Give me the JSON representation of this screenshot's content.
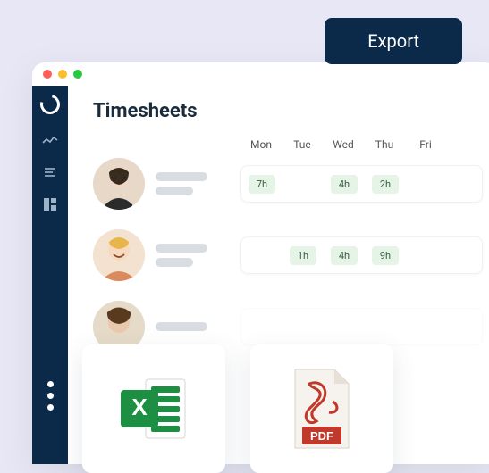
{
  "export_button": "Export",
  "page_title": "Timesheets",
  "days": [
    "Mon",
    "Tue",
    "Wed",
    "Thu",
    "Fri"
  ],
  "rows": [
    {
      "hours": [
        "7h",
        "",
        "4h",
        "2h",
        ""
      ]
    },
    {
      "hours": [
        "",
        "1h",
        "4h",
        "9h",
        ""
      ]
    },
    {
      "hours": [
        "",
        "",
        "",
        "",
        ""
      ]
    }
  ],
  "cards": {
    "excel_label": "Excel",
    "pdf_label": "PDF"
  },
  "colors": {
    "brand_dark": "#0b2a4a",
    "pill_bg": "#e6f4e8",
    "excel_green": "#1d8f42",
    "pdf_red": "#c0392b"
  }
}
